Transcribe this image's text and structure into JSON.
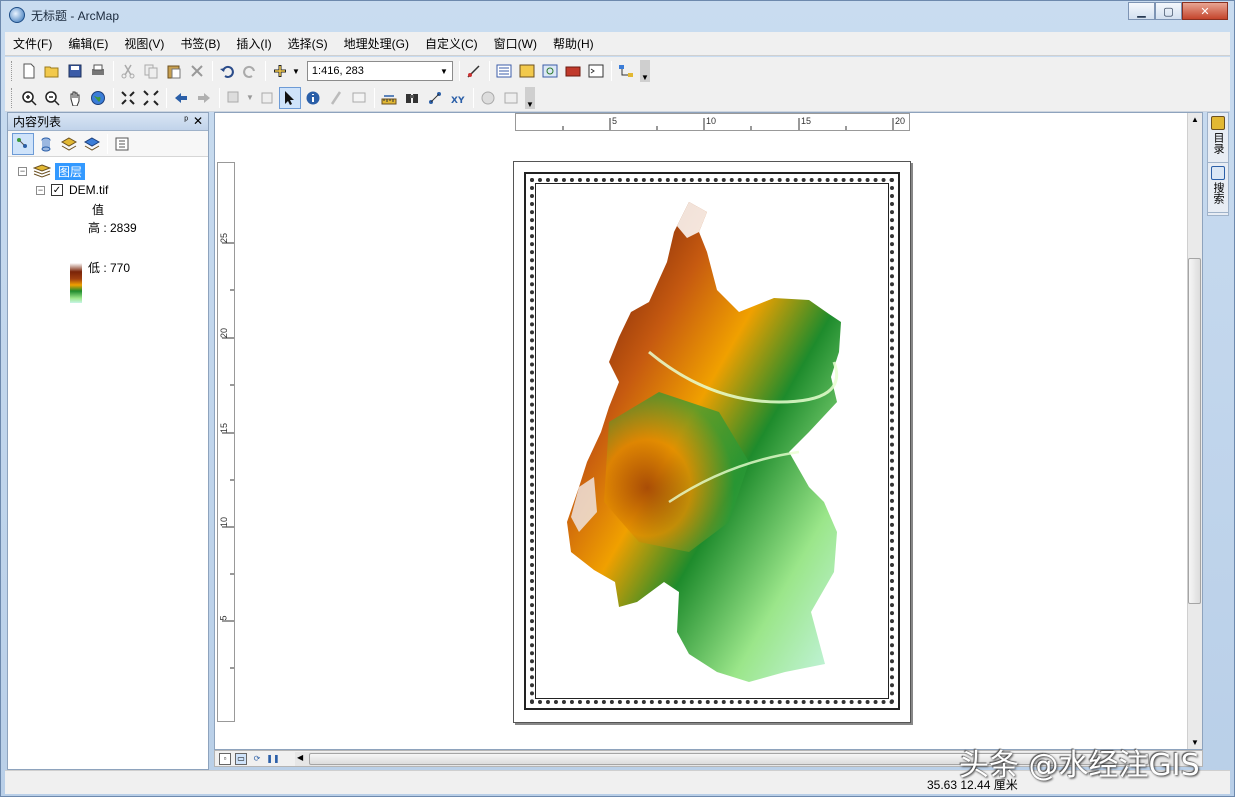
{
  "window": {
    "title": "无标题 - ArcMap"
  },
  "menu": [
    "文件(F)",
    "编辑(E)",
    "视图(V)",
    "书签(B)",
    "插入(I)",
    "选择(S)",
    "地理处理(G)",
    "自定义(C)",
    "窗口(W)",
    "帮助(H)"
  ],
  "toolbar": {
    "scale": "1:416, 283"
  },
  "toc": {
    "title": "内容列表",
    "pin": "ᵖ",
    "close": "✕",
    "layers_label": "图层",
    "layer_name": "DEM.tif",
    "checked": "✓",
    "legend_title": "值",
    "legend_high": "高 : 2839",
    "legend_low": "低 : 770"
  },
  "right_dock": {
    "catalog": "目录",
    "search": "搜索"
  },
  "rulers": {
    "horizontal": [
      "5",
      "10",
      "15",
      "20"
    ],
    "vertical": [
      "25",
      "20",
      "15",
      "10",
      "5"
    ]
  },
  "status": {
    "coords": "35.63  12.44 厘米"
  },
  "watermark": "头条 @水经注GIS",
  "colors": {
    "selection": "#3399ff",
    "title_gradient_top": "#c9dcf0"
  }
}
